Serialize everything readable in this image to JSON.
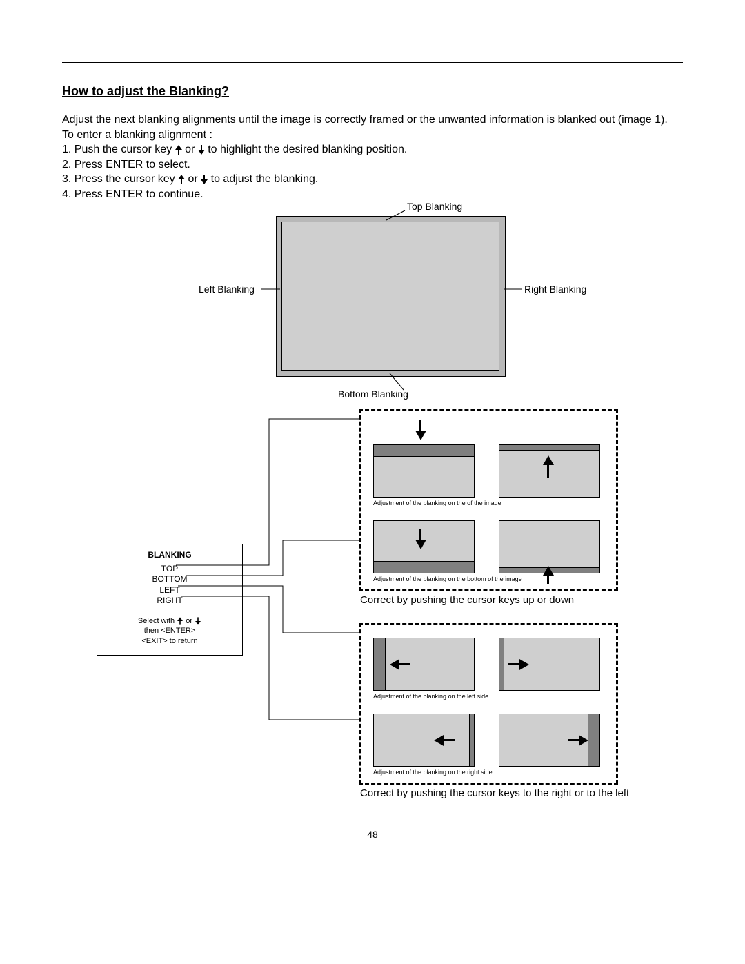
{
  "heading": "How to adjust the Blanking?",
  "intro": "Adjust the next blanking alignments until the image is correctly framed or the unwanted information is blanked out (image 1).",
  "enter_line": "To enter a blanking alignment :",
  "steps": {
    "s1a": "1. Push the cursor key ",
    "s1b": " or ",
    "s1c": " to highlight the desired blanking position.",
    "s2": "2. Press ENTER to select.",
    "s3a": "3. Press the cursor key ",
    "s3b": " or ",
    "s3c": " to adjust the blanking.",
    "s4": "4. Press ENTER to continue."
  },
  "diagram_labels": {
    "top": "Top Blanking",
    "left": "Left Blanking",
    "right": "Right Blanking",
    "bottom": "Bottom Blanking"
  },
  "menu": {
    "title": "BLANKING",
    "items": [
      "TOP",
      "BOTTOM",
      "LEFT",
      "RIGHT"
    ],
    "foot1a": "Select with ",
    "foot1b": " or ",
    "foot2": "then <ENTER>",
    "foot3": "<EXIT> to return"
  },
  "captions": {
    "adj_top": "Adjustment of the blanking on the of the image",
    "adj_bottom": "Adjustment of the blanking on the bottom of the image",
    "adj_left": "Adjustment of the blanking on the left side",
    "adj_right": "Adjustment of the blanking on the right side",
    "correct_v": "Correct by pushing the cursor keys up or down",
    "correct_h": "Correct by pushing the cursor keys to the right or to the left"
  },
  "page_number": "48"
}
